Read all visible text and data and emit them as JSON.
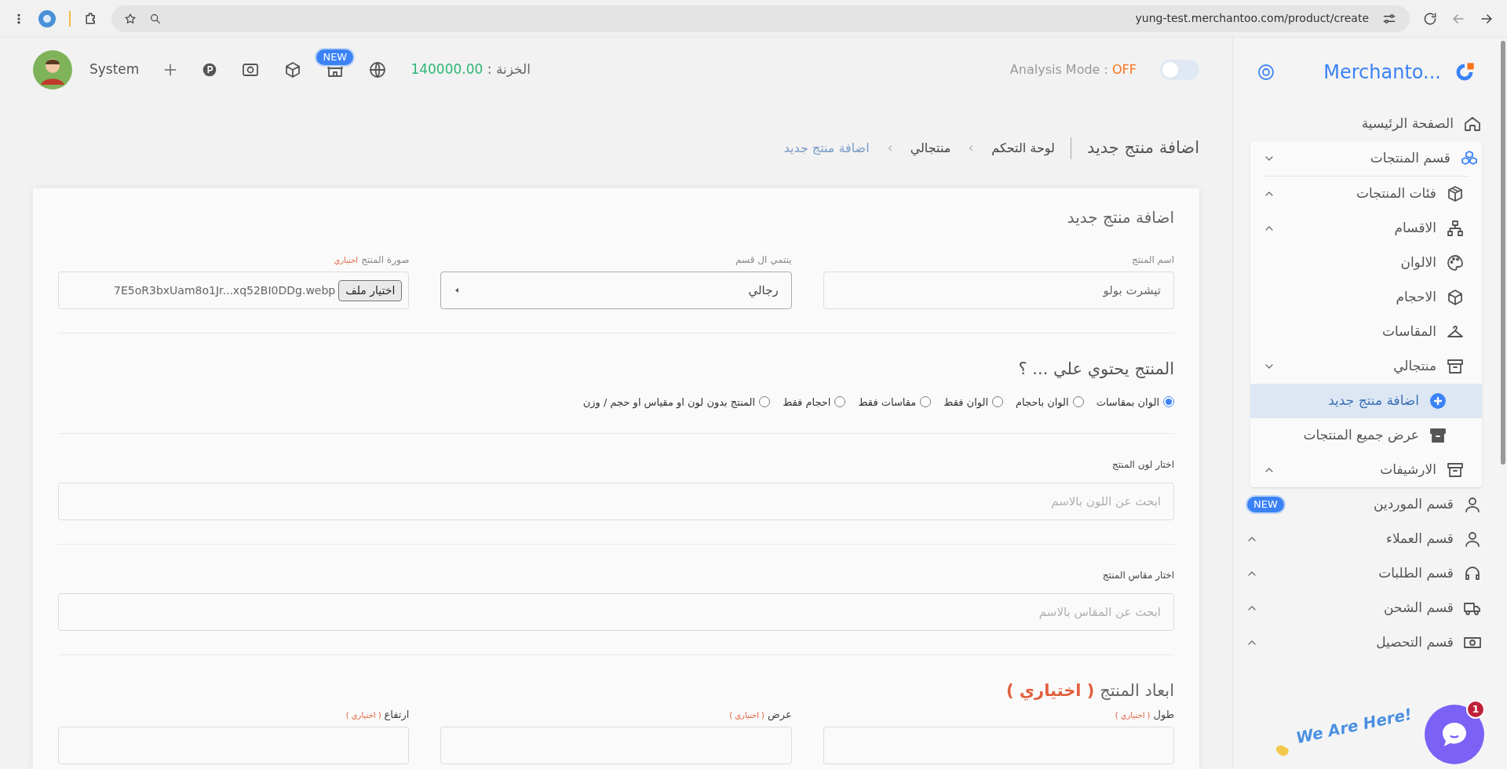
{
  "browser": {
    "url": "yung-test.merchantoo.com/product/create"
  },
  "header": {
    "user": "System",
    "badge": "NEW",
    "treasury_label": "الخزنة :",
    "treasury_value": "140000.00",
    "analysis_label": "Analysis Mode :",
    "analysis_value": "OFF",
    "analysis_on": false
  },
  "sidebar": {
    "brand": "Merchanto...",
    "items": [
      {
        "label": "الصفحة الرئيسية",
        "selected": false
      },
      {
        "label": "قسم المنتجات",
        "selected": false,
        "expanded": true,
        "children": [
          {
            "label": "فئات المنتجات",
            "selected": false,
            "expanded": false
          },
          {
            "label": "الاقسام",
            "selected": false,
            "expanded": false
          },
          {
            "label": "الالوان",
            "selected": false
          },
          {
            "label": "الاحجام",
            "selected": false
          },
          {
            "label": "المقاسات",
            "selected": false
          },
          {
            "label": "منتجالي",
            "selected": false,
            "expanded": true,
            "children": [
              {
                "label": "اضافة منتج جديد",
                "selected": true
              },
              {
                "label": "عرض جميع المنتجات",
                "selected": false
              }
            ]
          },
          {
            "label": "الارشيفات",
            "selected": false,
            "expanded": false
          }
        ]
      },
      {
        "label": "قسم الموردين",
        "selected": false,
        "badge": "NEW"
      },
      {
        "label": "قسم العملاء",
        "selected": false,
        "expanded": false
      },
      {
        "label": "قسم الطلبات",
        "selected": false,
        "expanded": false
      },
      {
        "label": "قسم الشحن",
        "selected": false,
        "expanded": false
      },
      {
        "label": "قسم التحصيل",
        "selected": false,
        "expanded": false
      }
    ]
  },
  "breadcrumb": {
    "title": "اضافة منتج جديد",
    "crumbs": [
      {
        "label": "لوحة التحكم",
        "selected": false
      },
      {
        "label": "منتجالي",
        "selected": false
      },
      {
        "label": "اضافة منتج جديد",
        "selected": true
      }
    ]
  },
  "form": {
    "title": "اضافة منتج جديد",
    "name_field": {
      "label": "اسم المنتج",
      "value": "تيشرت بولو"
    },
    "category_field": {
      "label": "ينتمي ال قسم",
      "value": "رجالي"
    },
    "image_field": {
      "label": "صورة المنتج",
      "optional": "اختياري",
      "button": "اختيار ملف",
      "filename": "7E5oR3bxUam8o1Jr...xq52BI0DDg.webp"
    },
    "contains": {
      "title": "المنتج يحتوي علي ... ؟",
      "options": [
        {
          "label": "الوان بمقاسات",
          "selected": true
        },
        {
          "label": "الوان باحجام",
          "selected": false
        },
        {
          "label": "الوان فقط",
          "selected": false
        },
        {
          "label": "مقاسات فقط",
          "selected": false
        },
        {
          "label": "احجام فقط",
          "selected": false
        },
        {
          "label": "المنتج بدون لون او مقياس او حجم / وزن",
          "selected": false
        }
      ]
    },
    "color_picker": {
      "label": "اختار لون المنتج",
      "placeholder": "ابحث عن اللون بالاسم"
    },
    "size_picker": {
      "label": "اختار مقاس المنتج",
      "placeholder": "ابحث عن المقاس بالاسم"
    },
    "dimensions": {
      "title": "ابعاد المنتج",
      "optional": "( اختياري )",
      "fields": [
        {
          "label": "طول",
          "optional": "( اختياري )"
        },
        {
          "label": "عرض",
          "optional": "( اختياري )"
        },
        {
          "label": "ارتفاع",
          "optional": "( اختياري )"
        }
      ]
    }
  },
  "chat": {
    "badge": "1",
    "tagline": "We Are Here!"
  }
}
